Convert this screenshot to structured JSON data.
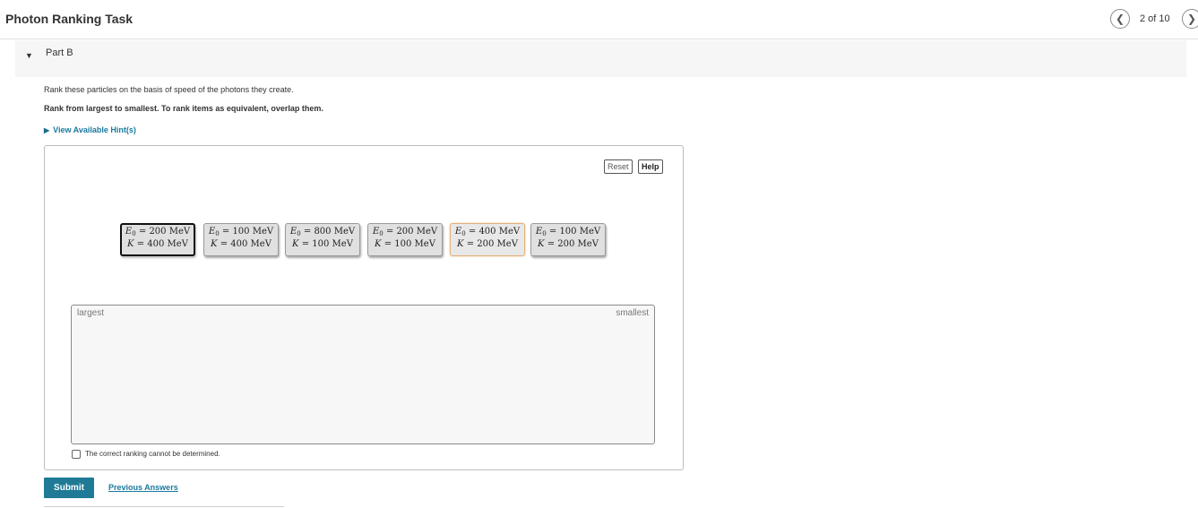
{
  "header": {
    "title": "Photon Ranking Task",
    "page_count": "2 of 10",
    "prev_icon": "chevron-left-icon",
    "next_icon": "chevron-right-icon"
  },
  "part": {
    "label": "Part B",
    "caret_icon": "caret-down-icon"
  },
  "question": {
    "prompt": "Rank these particles on the basis of speed of the photons they create.",
    "instruction": "Rank from largest to smallest. To rank items as equivalent, overlap them.",
    "hint_link": "View Available Hint(s)"
  },
  "panel": {
    "reset_label": "Reset",
    "help_label": "Help",
    "tiles": [
      {
        "e0": "200 MeV",
        "k": "400 MeV"
      },
      {
        "e0": "100 MeV",
        "k": "400 MeV"
      },
      {
        "e0": "800 MeV",
        "k": "100 MeV"
      },
      {
        "e0": "200 MeV",
        "k": "100 MeV"
      },
      {
        "e0": "400 MeV",
        "k": "200 MeV"
      },
      {
        "e0": "100 MeV",
        "k": "200 MeV"
      }
    ],
    "zone_left_label": "largest",
    "zone_right_label": "smallest",
    "checkbox_label": "The correct ranking cannot be determined."
  },
  "footer": {
    "submit_label": "Submit",
    "previous_answers_label": "Previous Answers"
  },
  "colors": {
    "accent": "#1f7a96",
    "link": "#1a7a9e"
  }
}
